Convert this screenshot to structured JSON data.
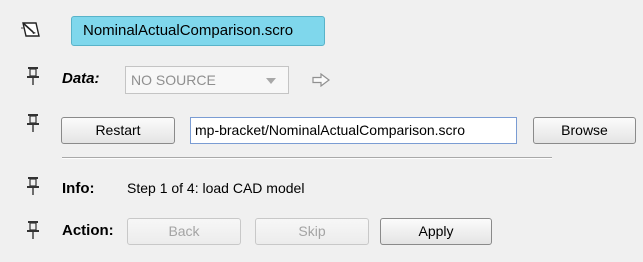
{
  "header": {
    "title": "NominalActualComparison.scro",
    "icon": "edit-script-icon"
  },
  "data_row": {
    "label": "Data:",
    "source_value": "NO SOURCE",
    "pin_icon": "pin-icon",
    "action_icon": "arrow-right-icon"
  },
  "file_row": {
    "restart_label": "Restart",
    "path_value": "mp-bracket/NominalActualComparison.scro",
    "browse_label": "Browse"
  },
  "info_row": {
    "label": "Info:",
    "text": "Step 1 of 4: load CAD model"
  },
  "action_row": {
    "label": "Action:",
    "back_label": "Back",
    "skip_label": "Skip",
    "apply_label": "Apply"
  },
  "colors": {
    "title_bg": "#7fd7ec",
    "background": "#f0f0f0"
  }
}
